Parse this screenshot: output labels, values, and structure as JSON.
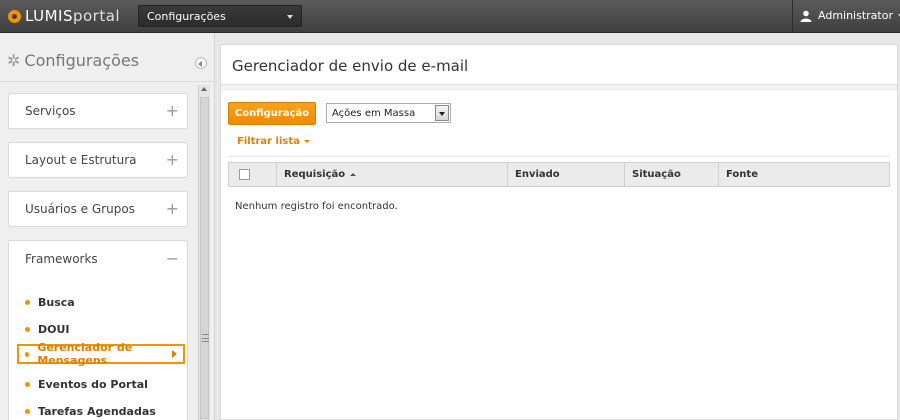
{
  "topbar": {
    "logo_primary": "LUMIS",
    "logo_secondary": "portal",
    "section_select": "Configurações",
    "user_name": "Administrator"
  },
  "sidebar": {
    "header": "Configurações",
    "panels": [
      {
        "label": "Serviços",
        "toggle": "+"
      },
      {
        "label": "Layout e Estrutura",
        "toggle": "+"
      },
      {
        "label": "Usuários e Grupos",
        "toggle": "+"
      },
      {
        "label": "Frameworks",
        "toggle": "−"
      }
    ],
    "framework_items": [
      {
        "label": "Busca"
      },
      {
        "label": "DOUI"
      },
      {
        "label": "Gerenciador de Mensagens",
        "active": true
      },
      {
        "label": "Eventos do Portal"
      },
      {
        "label": "Tarefas Agendadas"
      }
    ]
  },
  "main": {
    "title": "Gerenciador de envio de e-mail",
    "config_button": "Configuração",
    "mass_actions": "Ações em Massa",
    "filter_link": "Filtrar lista",
    "columns": [
      "Requisição",
      "Enviado",
      "Situação",
      "Fonte"
    ],
    "empty_message": "Nenhum registro foi encontrado."
  },
  "colors": {
    "accent": "#f29400",
    "topbar": "#4a4a4a"
  }
}
